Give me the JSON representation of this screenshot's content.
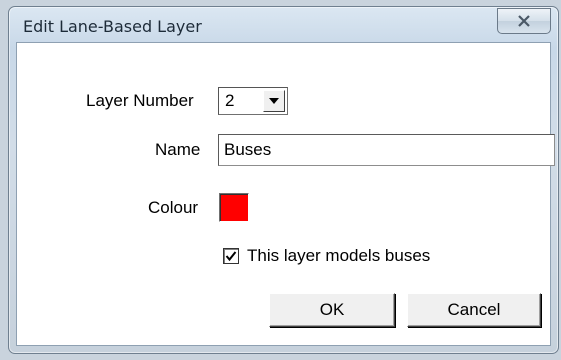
{
  "window": {
    "title": "Edit Lane-Based Layer"
  },
  "form": {
    "layer_number_label": "Layer Number",
    "layer_number_value": "2",
    "name_label": "Name",
    "name_value": "Buses",
    "colour_label": "Colour",
    "colour_value": "#ff0000",
    "bus_checkbox_label": "This layer models buses",
    "bus_checkbox_checked": true
  },
  "buttons": {
    "ok": "OK",
    "cancel": "Cancel"
  },
  "icons": {
    "close": "close-icon",
    "dropdown": "dropdown-arrow-icon",
    "check": "checkmark-icon"
  }
}
